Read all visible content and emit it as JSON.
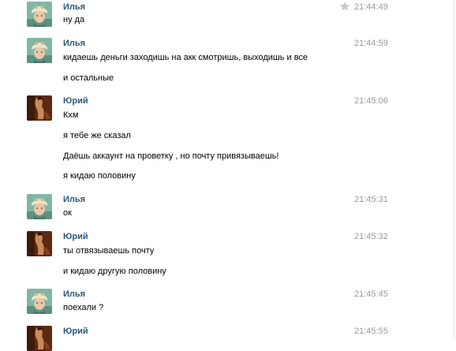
{
  "messages": [
    {
      "author": "Илья",
      "time": "21:44:49",
      "avatar": "avatar-ilya",
      "starred": true,
      "lines": [
        "ну да"
      ]
    },
    {
      "author": "Илья",
      "time": "21:44:59",
      "avatar": "avatar-ilya",
      "lines": [
        "кидаешь деньги заходишь на акк смотришь, выходишь и все",
        "и остальные"
      ]
    },
    {
      "author": "Юрий",
      "time": "21:45:06",
      "avatar": "avatar-yuriy",
      "lines": [
        "Кхм",
        "я тебе же сказал",
        "Даёшь аккаунт на проветку , но почту привязываешь!",
        "я кидаю половину"
      ]
    },
    {
      "author": "Илья",
      "time": "21:45:31",
      "avatar": "avatar-ilya",
      "lines": [
        "ок"
      ]
    },
    {
      "author": "Юрий",
      "time": "21:45:32",
      "avatar": "avatar-yuriy",
      "lines": [
        "ты отвязываешь почту",
        "и кидаю другую половину"
      ]
    },
    {
      "author": "Илья",
      "time": "21:45:45",
      "avatar": "avatar-ilya",
      "lines": [
        "поехали ?"
      ]
    },
    {
      "author": "Юрий",
      "time": "21:45:55",
      "avatar": "avatar-yuriy",
      "lines": []
    }
  ],
  "colors": {
    "author": "#2b587a",
    "time": "#999999",
    "text": "#000000",
    "star": "#c8c8c8"
  }
}
